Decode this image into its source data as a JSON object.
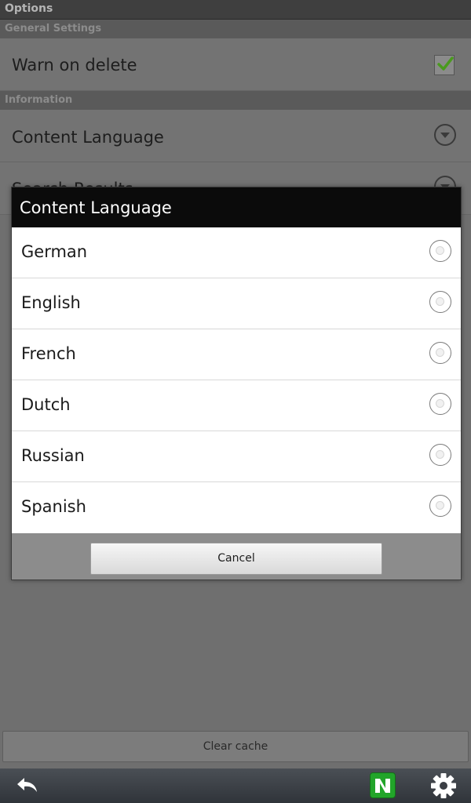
{
  "titlebar": {
    "title": "Options"
  },
  "sections": {
    "general": "General Settings",
    "information": "Information"
  },
  "prefs": {
    "warn_on_delete": {
      "label": "Warn on delete",
      "checked": true
    },
    "content_language": {
      "label": "Content Language"
    },
    "search_results": {
      "label": "Search Results"
    }
  },
  "dialog": {
    "title": "Content Language",
    "options": [
      "German",
      "English",
      "French",
      "Dutch",
      "Russian",
      "Spanish"
    ],
    "cancel_label": "Cancel"
  },
  "footer": {
    "clear_cache_label": "Clear cache"
  },
  "bottombar": {
    "back_icon": "back-arrow-icon",
    "app_icon": "app-n-icon",
    "settings_icon": "gear-icon"
  },
  "colors": {
    "checkmark": "#4a9a1e",
    "app_icon_bg": "#22a52a"
  }
}
